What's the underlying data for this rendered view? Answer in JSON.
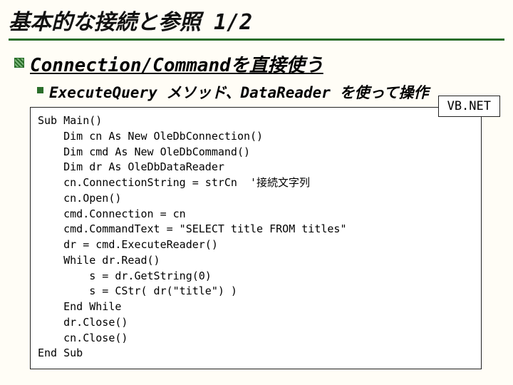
{
  "title": "基本的な接続と参照 1/2",
  "bullet1": "Connection/Commandを直接使う",
  "bullet2": "ExecuteQuery メソッド、DataReader を使って操作",
  "lang_tag": "VB.NET",
  "code": "Sub Main()\n    Dim cn As New OleDbConnection()\n    Dim cmd As New OleDbCommand()\n    Dim dr As OleDbDataReader\n    cn.ConnectionString = strCn  '接続文字列\n    cn.Open()\n    cmd.Connection = cn\n    cmd.CommandText = \"SELECT title FROM titles\"\n    dr = cmd.ExecuteReader()\n    While dr.Read()\n        s = dr.GetString(0)\n        s = CStr( dr(\"title\") )\n    End While\n    dr.Close()\n    cn.Close()\nEnd Sub"
}
